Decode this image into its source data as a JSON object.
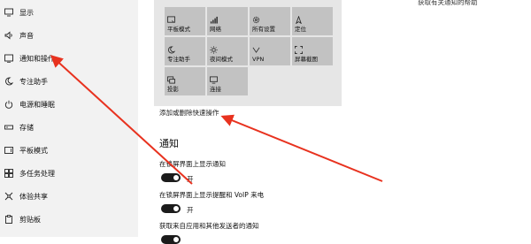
{
  "sidebar": {
    "items": [
      {
        "label": "显示",
        "icon": "monitor-icon"
      },
      {
        "label": "声音",
        "icon": "speaker-icon"
      },
      {
        "label": "通知和操作",
        "icon": "notification-icon"
      },
      {
        "label": "专注助手",
        "icon": "moon-icon"
      },
      {
        "label": "电源和睡眠",
        "icon": "power-icon"
      },
      {
        "label": "存储",
        "icon": "storage-icon"
      },
      {
        "label": "平板模式",
        "icon": "tablet-icon"
      },
      {
        "label": "多任务处理",
        "icon": "multitask-icon"
      },
      {
        "label": "体验共享",
        "icon": "share-icon"
      },
      {
        "label": "剪贴板",
        "icon": "clipboard-icon"
      }
    ]
  },
  "top_note": "获取有关通知的帮助",
  "quick_actions": {
    "tiles": [
      {
        "label": "平板模式",
        "icon": "tablet-mode-icon"
      },
      {
        "label": "网络",
        "icon": "network-icon"
      },
      {
        "label": "所有设置",
        "icon": "gear-icon"
      },
      {
        "label": "定位",
        "icon": "location-icon"
      },
      {
        "label": "专注助手",
        "icon": "moon-icon"
      },
      {
        "label": "夜间模式",
        "icon": "sun-icon"
      },
      {
        "label": "VPN",
        "icon": "vpn-icon"
      },
      {
        "label": "屏幕截图",
        "icon": "screenshot-icon"
      },
      {
        "label": "投影",
        "icon": "project-icon"
      },
      {
        "label": "连接",
        "icon": "connect-icon"
      }
    ],
    "edit_link": "添加或删除快速操作"
  },
  "notifications": {
    "heading": "通知",
    "settings": [
      {
        "label": "在锁屏界面上显示通知",
        "state": "开",
        "on": true
      },
      {
        "label": "在锁屏界面上显示提醒和 VoIP 来电",
        "state": "开",
        "on": true
      },
      {
        "label": "获取来自应用和其他发送者的通知",
        "state": "开",
        "on": true
      }
    ]
  },
  "colors": {
    "sidebar_bg": "#f2f2f2",
    "tile_bg": "#c2c2c2",
    "panel_bg": "#e6e6e6",
    "toggle_on": "#1b1b1b",
    "arrow": "#e8321f"
  }
}
